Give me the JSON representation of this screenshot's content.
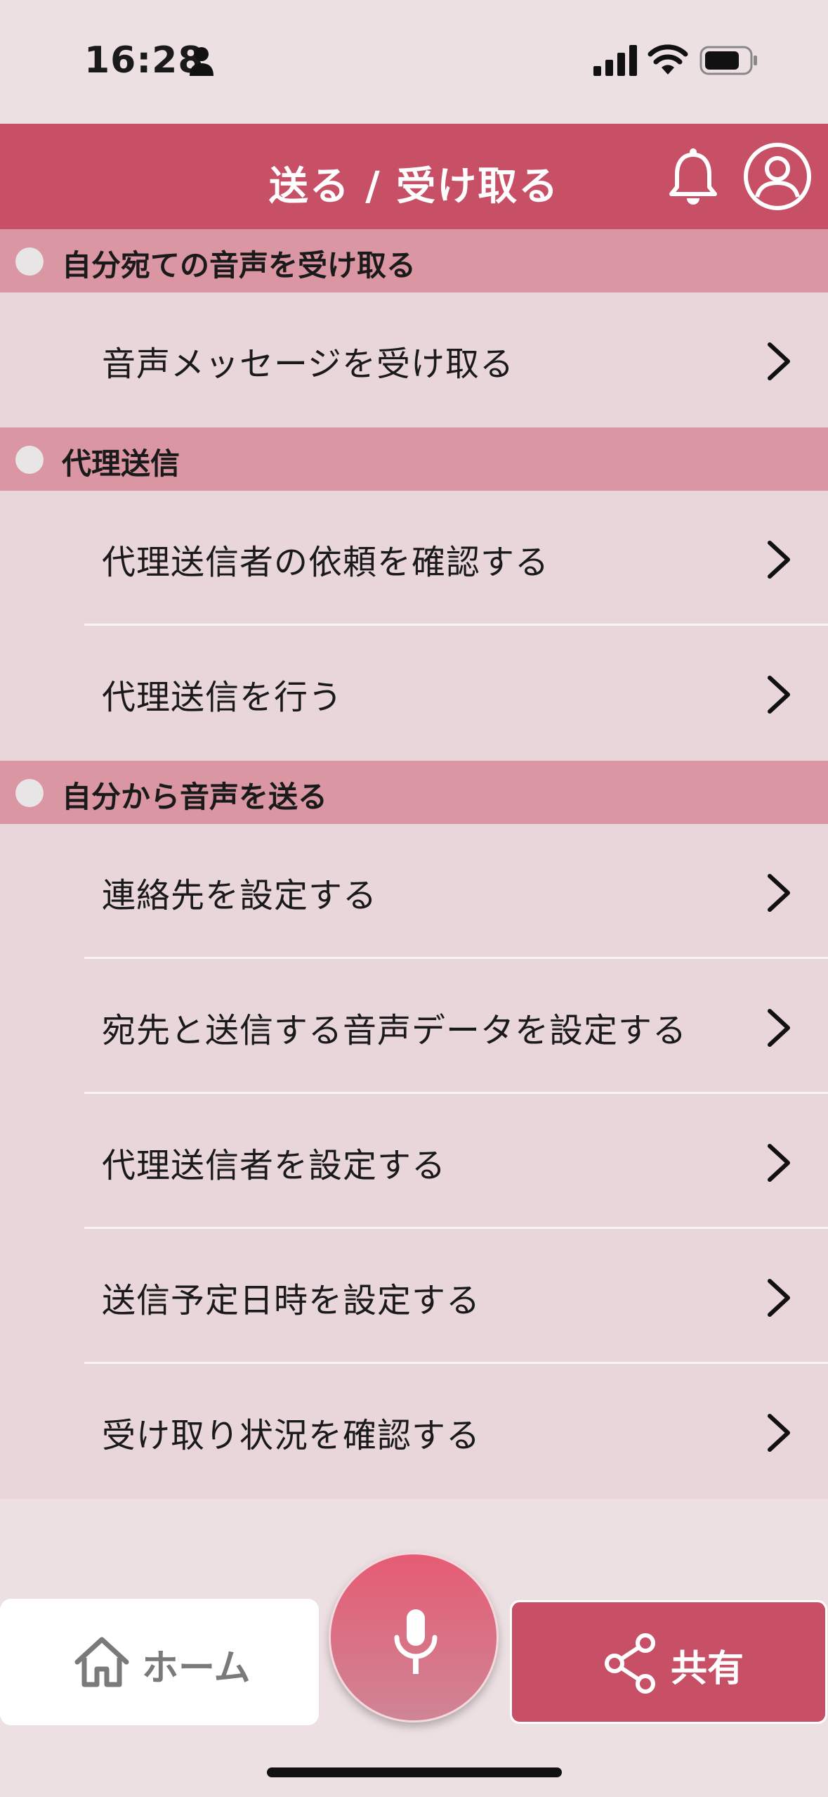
{
  "status_bar": {
    "time": "16:28"
  },
  "header": {
    "title": "送る / 受け取る"
  },
  "sections": [
    {
      "title": "自分宛ての音声を受け取る",
      "items": [
        {
          "label": "音声メッセージを受け取る"
        }
      ]
    },
    {
      "title": "代理送信",
      "items": [
        {
          "label": "代理送信者の依頼を確認する"
        },
        {
          "label": "代理送信を行う"
        }
      ]
    },
    {
      "title": "自分から音声を送る",
      "items": [
        {
          "label": "連絡先を設定する"
        },
        {
          "label": "宛先と送信する音声データを設定する"
        },
        {
          "label": "代理送信者を設定する"
        },
        {
          "label": "送信予定日時を設定する"
        },
        {
          "label": "受け取り状況を確認する"
        }
      ]
    }
  ],
  "bottom_nav": {
    "home_label": "ホーム",
    "share_label": "共有"
  },
  "colors": {
    "accent": "#c85066",
    "section_header": "#da97a3",
    "row_background": "#e9d6da",
    "page_background": "#ede0e3"
  },
  "icons": {
    "status": [
      "person-icon",
      "signal-icon",
      "wifi-icon",
      "battery-icon"
    ],
    "header": [
      "bell-icon",
      "account-icon"
    ],
    "row": "chevron-right-icon",
    "nav": [
      "home-icon",
      "microphone-icon",
      "share-icon"
    ]
  }
}
